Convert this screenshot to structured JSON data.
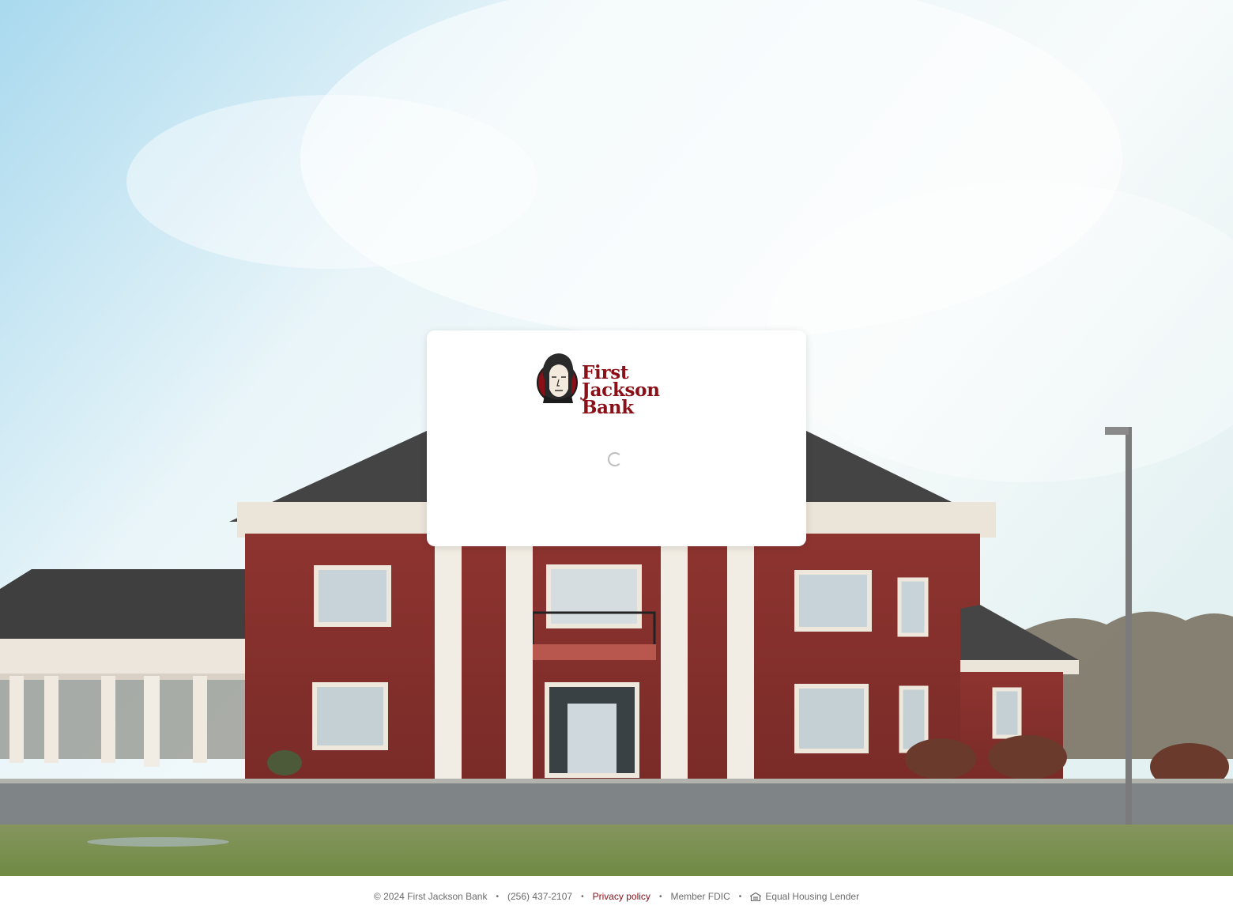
{
  "brand": {
    "name_line1": "First Jackson",
    "name_line2": "Bank",
    "color": "#8a0f16"
  },
  "card": {
    "status": "loading"
  },
  "footer": {
    "copyright": "© 2024 First Jackson Bank",
    "phone": "(256) 437-2107",
    "privacy_label": "Privacy policy",
    "fdic": "Member FDIC",
    "equal_housing": "Equal Housing Lender",
    "separator": "•"
  },
  "icons": {
    "logo": "portrait-logo-icon",
    "spinner": "loading-spinner-icon",
    "equal_housing": "house-icon"
  }
}
